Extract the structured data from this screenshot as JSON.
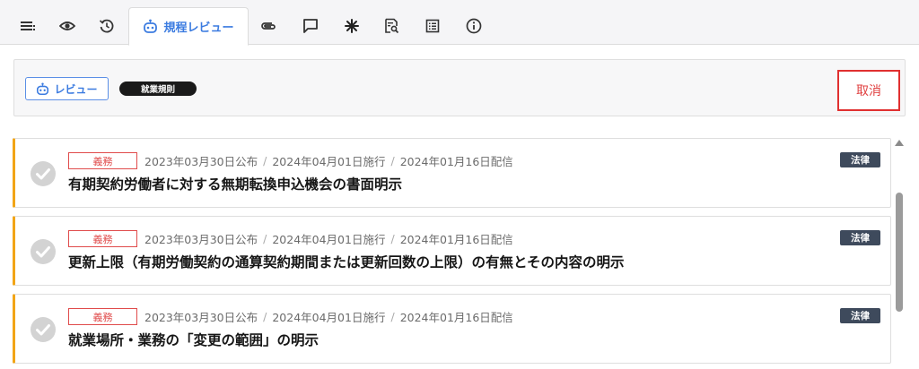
{
  "tabs": [
    {
      "name": "list-icon"
    },
    {
      "name": "eye-icon"
    },
    {
      "name": "history-icon"
    },
    {
      "name": "robot-icon",
      "label": "規程レビュー",
      "active": true
    },
    {
      "name": "paperclip-icon"
    },
    {
      "name": "comment-icon"
    },
    {
      "name": "asterisk-icon"
    },
    {
      "name": "document-search-icon"
    },
    {
      "name": "table-icon"
    },
    {
      "name": "info-icon"
    }
  ],
  "actionbar": {
    "review_label": "レビュー",
    "rule_chip": "就業規則",
    "cancel_label": "取消"
  },
  "items": [
    {
      "badge": "義務",
      "published": "2023年03月30日公布",
      "effective": "2024年04月01日施行",
      "delivered": "2024年01月16日配信",
      "category": "法律",
      "title": "有期契約労働者に対する無期転換申込機会の書面明示"
    },
    {
      "badge": "義務",
      "published": "2023年03月30日公布",
      "effective": "2024年04月01日施行",
      "delivered": "2024年01月16日配信",
      "category": "法律",
      "title": "更新上限（有期労働契約の通算契約期間または更新回数の上限）の有無とその内容の明示"
    },
    {
      "badge": "義務",
      "published": "2023年03月30日公布",
      "effective": "2024年04月01日施行",
      "delivered": "2024年01月16日配信",
      "category": "法律",
      "title": "就業場所・業務の「変更の範囲」の明示"
    }
  ],
  "colors": {
    "accent": "#3b7be0",
    "cancel": "#e04040",
    "duty": "#e04b4b",
    "card_left_border": "#f2a516",
    "law_badge": "#3e4a5c"
  }
}
